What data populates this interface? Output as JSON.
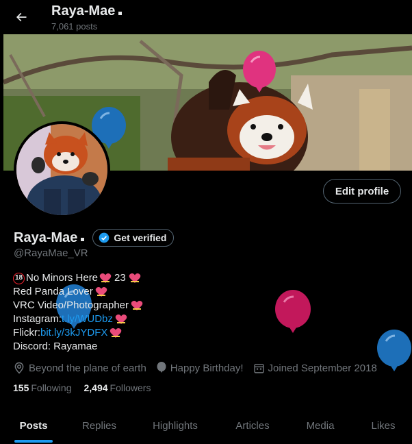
{
  "header": {
    "name": "Raya-Mae",
    "posts_count": "7,061 posts"
  },
  "profile": {
    "display_name": "Raya-Mae",
    "handle": "@RayaMae_VR",
    "edit_button": "Edit profile",
    "verify_label": "Get verified"
  },
  "bio": {
    "line1_badge": "18",
    "line1_text": "No Minors Here",
    "line1_age": "23",
    "line2": "Red Panda Lover",
    "line3": "VRC Video/Photographer",
    "line4_label": "Instagram: ",
    "line4_link": "t.ly/WUDbz",
    "line5_label": "Flickr: ",
    "line5_link": "bit.ly/3kJYDFX",
    "line6": "Discord: Rayamae"
  },
  "meta": {
    "location": "Beyond the plane of earth",
    "birthday": "Happy Birthday!",
    "joined": "Joined September 2018"
  },
  "stats": {
    "following_count": "155",
    "following_label": "Following",
    "followers_count": "2,494",
    "followers_label": "Followers"
  },
  "tabs": [
    {
      "label": "Posts"
    },
    {
      "label": "Replies"
    },
    {
      "label": "Highlights"
    },
    {
      "label": "Articles"
    },
    {
      "label": "Media"
    },
    {
      "label": "Likes"
    }
  ],
  "colors": {
    "accent": "#1d9bf0",
    "background": "#000000",
    "text_primary": "#e7e9ea",
    "text_secondary": "#71767b",
    "balloon_blue": "#1d6fb8",
    "balloon_pink": "#e0337f",
    "balloon_magenta": "#c2185b"
  }
}
